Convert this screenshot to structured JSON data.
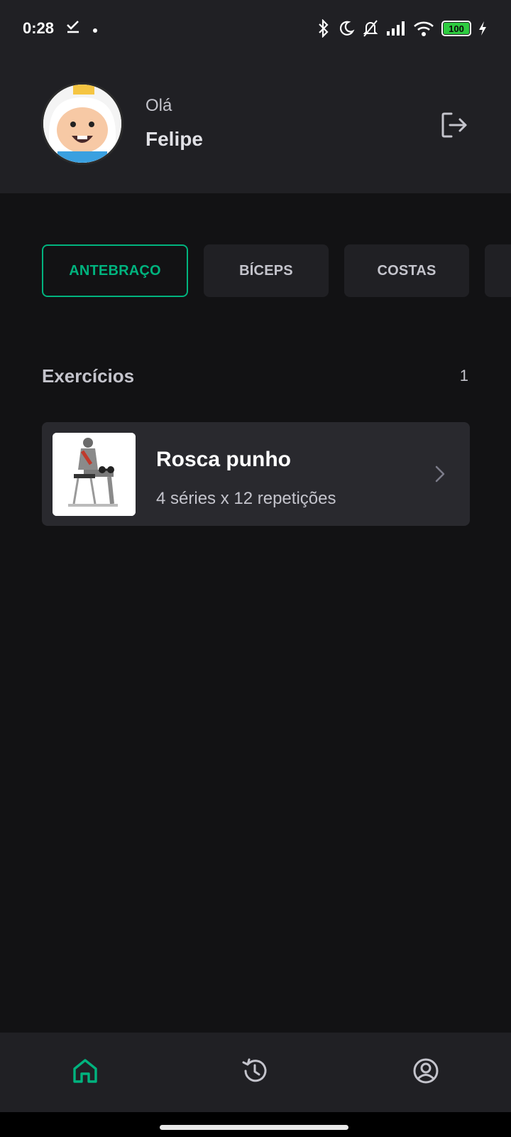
{
  "status_bar": {
    "time": "0:28",
    "battery": "100"
  },
  "header": {
    "greeting": "Olá",
    "username": "Felipe"
  },
  "groups": [
    {
      "label": "ANTEBRAÇO",
      "active": true
    },
    {
      "label": "BÍCEPS",
      "active": false
    },
    {
      "label": "COSTAS",
      "active": false
    }
  ],
  "exercises": {
    "title": "Exercícios",
    "count": "1",
    "items": [
      {
        "name": "Rosca punho",
        "details": "4 séries x 12 repetições"
      }
    ]
  },
  "colors": {
    "accent": "#00b37e",
    "background": "#121214",
    "surface": "#202024",
    "card": "#29292e"
  },
  "icons": {
    "logout": "logout-icon",
    "home": "home-icon",
    "history": "history-icon",
    "profile": "profile-icon"
  }
}
